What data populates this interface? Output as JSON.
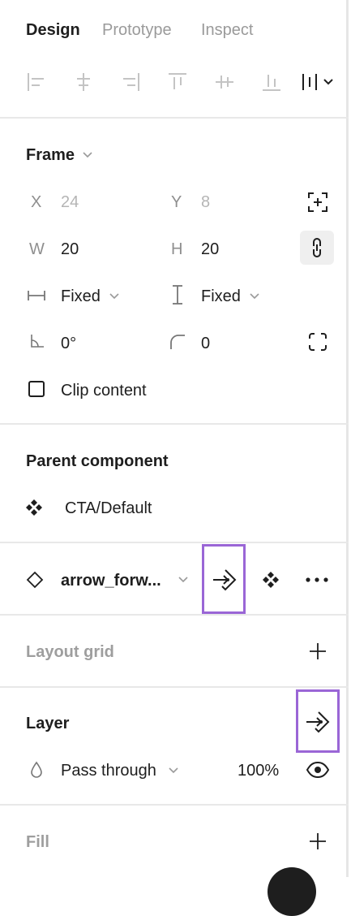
{
  "tabs": {
    "design": "Design",
    "prototype": "Prototype",
    "inspect": "Inspect"
  },
  "frame": {
    "title": "Frame",
    "x_label": "X",
    "x_value": "24",
    "y_label": "Y",
    "y_value": "8",
    "w_label": "W",
    "w_value": "20",
    "h_label": "H",
    "h_value": "20",
    "width_sizing": "Fixed",
    "height_sizing": "Fixed",
    "rotation": "0°",
    "corner_radius": "0",
    "clip_content": "Clip content"
  },
  "parent_component": {
    "title": "Parent component",
    "name": "CTA/Default"
  },
  "instance": {
    "name": "arrow_forw..."
  },
  "layout_grid": {
    "title": "Layout grid"
  },
  "layer": {
    "title": "Layer",
    "blend_mode": "Pass through",
    "opacity": "100%"
  },
  "fill": {
    "title": "Fill"
  },
  "colors": {
    "highlight": "#9a66d6",
    "text": "#1e1e1e",
    "muted": "#9a9a9a"
  }
}
